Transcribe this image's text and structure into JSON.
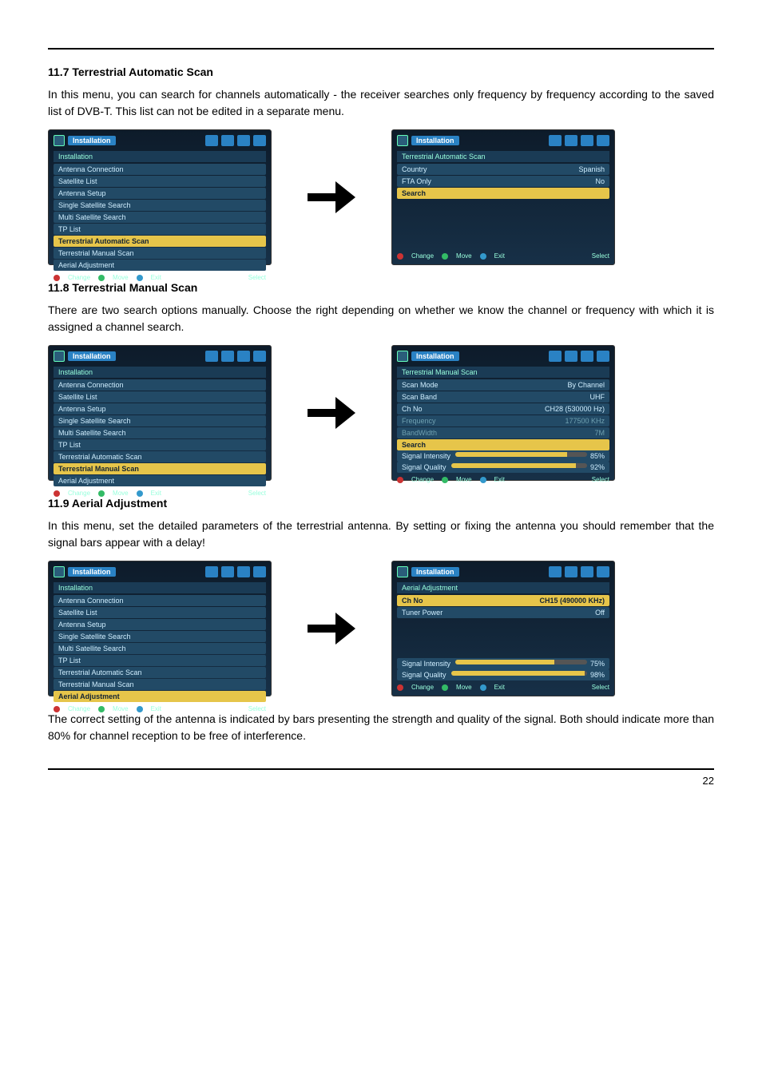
{
  "page_number": "22",
  "sections": {
    "s1": {
      "title": "11.7 Terrestrial Automatic Scan",
      "body": "In this menu, you can search for channels automatically - the receiver searches only frequency by frequency according to the saved list of DVB-T. This list can not be edited in a separate menu."
    },
    "s2": {
      "title": "11.8 Terrestrial Manual Scan",
      "body": "There are two search options manually. Choose the right depending on whether we know the channel or frequency with which it is assigned a channel search."
    },
    "s3": {
      "title": "11.9 Aerial Adjustment",
      "body1": "In this menu, set the detailed parameters of the terrestrial antenna. By setting or fixing the antenna you should remember that the signal bars appear with a delay!",
      "body2": "The correct setting of the antenna is indicated by bars presenting the strength and quality of the signal. Both should indicate more than 80% for channel reception to be free of interference."
    }
  },
  "shots": {
    "install_menu": {
      "title": "Installation",
      "sub": "Installation",
      "items": [
        "Antenna Connection",
        "Satellite List",
        "Antenna Setup",
        "Single Satellite Search",
        "Multi Satellite Search",
        "TP List",
        "Terrestrial Automatic Scan",
        "Terrestrial Manual Scan",
        "Aerial Adjustment"
      ],
      "foot": {
        "change": "Change",
        "move": "Move",
        "exit": "Exit",
        "select": "Select"
      }
    },
    "auto_scan": {
      "title": "Installation",
      "sub": "Terrestrial Automatic Scan",
      "rows": [
        {
          "label": "Country",
          "value": "Spanish"
        },
        {
          "label": "FTA Only",
          "value": "No"
        },
        {
          "label": "Search",
          "value": "",
          "sel": true
        }
      ]
    },
    "manual_scan": {
      "title": "Installation",
      "sub": "Terrestrial Manual Scan",
      "rows": [
        {
          "label": "Scan Mode",
          "value": "By Channel"
        },
        {
          "label": "Scan Band",
          "value": "UHF"
        },
        {
          "label": "Ch No",
          "value": "CH28 (530000 Hz)"
        },
        {
          "label": "Frequency",
          "value": "177500 KHz",
          "dim": true
        },
        {
          "label": "BandWidth",
          "value": "7M",
          "dim": true
        },
        {
          "label": "Search",
          "value": "",
          "sel": true
        }
      ],
      "bars": [
        {
          "label": "Signal Intensity",
          "percent": "85%",
          "fill": 85
        },
        {
          "label": "Signal Quality",
          "percent": "92%",
          "fill": 92
        }
      ]
    },
    "aerial": {
      "title": "Installation",
      "sub": "Aerial Adjustment",
      "rows": [
        {
          "label": "Ch No",
          "value": "CH15 (490000 KHz)",
          "sel": true
        },
        {
          "label": "Tuner Power",
          "value": "Off"
        }
      ],
      "bars": [
        {
          "label": "Signal Intensity",
          "percent": "75%",
          "fill": 75
        },
        {
          "label": "Signal Quality",
          "percent": "98%",
          "fill": 98
        }
      ]
    },
    "install_menu_sel": {
      "sel_auto": "Terrestrial Automatic Scan",
      "sel_manual": "Terrestrial Manual Scan",
      "sel_aerial": "Aerial Adjustment"
    }
  }
}
